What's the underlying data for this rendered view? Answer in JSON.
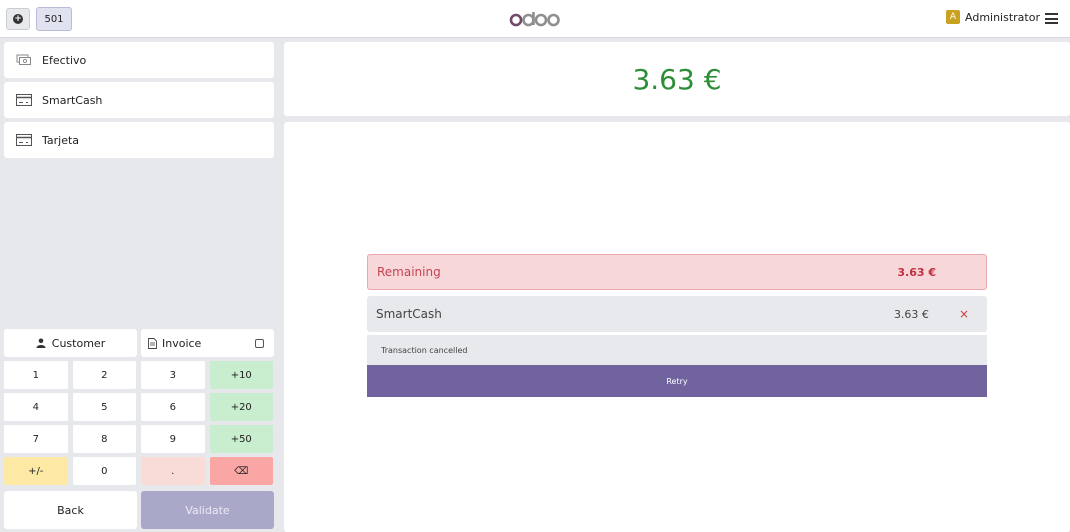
{
  "header": {
    "order_number": "501",
    "logo_text": "odoo",
    "user_initial": "A",
    "user_name": "Administrator"
  },
  "payment_methods": [
    {
      "label": "Efectivo",
      "icon": "cash-icon"
    },
    {
      "label": "SmartCash",
      "icon": "card-icon"
    },
    {
      "label": "Tarjeta",
      "icon": "card-icon"
    }
  ],
  "actions": {
    "customer_label": "Customer",
    "invoice_label": "Invoice",
    "invoice_checked": false
  },
  "numpad": {
    "keys": [
      "1",
      "2",
      "3",
      "+10",
      "4",
      "5",
      "6",
      "+20",
      "7",
      "8",
      "9",
      "+50",
      "+/-",
      "0",
      ".",
      "⌫"
    ]
  },
  "buttons": {
    "back": "Back",
    "validate": "Validate"
  },
  "total": {
    "amount": "3.63 €"
  },
  "remaining": {
    "label": "Remaining",
    "amount": "3.63 €"
  },
  "payment_line": {
    "method": "SmartCash",
    "amount": "3.63 €",
    "delete_glyph": "×"
  },
  "transaction": {
    "status": "Transaction cancelled",
    "retry_label": "Retry"
  },
  "colors": {
    "accent": "#71639e",
    "total_green": "#2c8f37",
    "remaining_red": "#c0303e"
  }
}
